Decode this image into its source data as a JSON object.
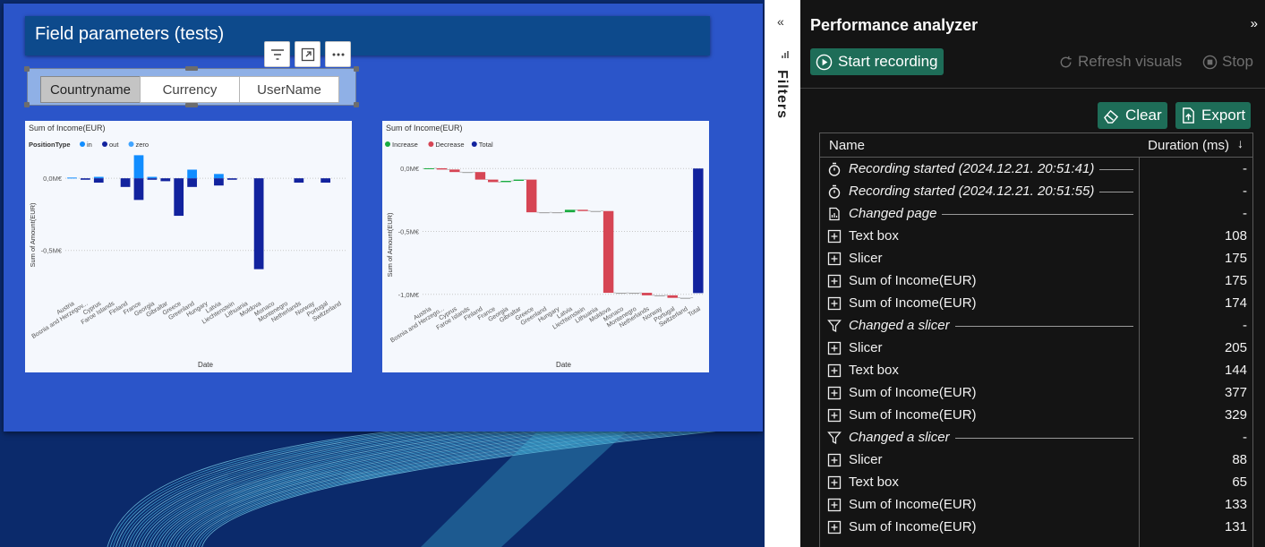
{
  "report": {
    "title": "Field parameters (tests)",
    "slicer": {
      "options": [
        "Countryname",
        "Currency",
        "UserName"
      ],
      "selected_index": 0
    },
    "toolbar_icons": [
      "filter-icon",
      "focus-mode-icon",
      "more-options-icon"
    ]
  },
  "chart_data": [
    {
      "type": "bar",
      "title": "Sum of Income(EUR)",
      "legend_title": "PositionType",
      "legend_position": "top-left",
      "xlabel": "Date",
      "ylabel": "Sum of Amount(EUR)",
      "y_ticks": [
        "0,0M€",
        "-0,5M€"
      ],
      "ylim": [
        -0.75,
        0.15
      ],
      "grid": true,
      "categories": [
        "Austria",
        "Bosnia and Herzegov...",
        "Cyprus",
        "Faroe Islands",
        "Finland",
        "France",
        "Georgia",
        "Gibraltar",
        "Greece",
        "Greenland",
        "Hungary",
        "Latvia",
        "Liechtenstein",
        "Lithuania",
        "Moldova",
        "Monaco",
        "Montenegro",
        "Netherlands",
        "Norway",
        "Portugal",
        "Switzerland"
      ],
      "series": [
        {
          "name": "in",
          "color": "#118dff",
          "values": [
            0.005,
            0.0,
            0.01,
            0.0,
            0.0,
            0.16,
            0.01,
            0.0,
            0.0,
            0.06,
            0.0,
            0.03,
            0.0,
            0.0,
            0.0,
            0.0,
            0.0,
            0.0,
            0.0,
            0.0,
            0.0
          ]
        },
        {
          "name": "out",
          "color": "#12239e",
          "values": [
            0.0,
            -0.01,
            -0.03,
            0.0,
            -0.06,
            -0.15,
            -0.01,
            -0.02,
            -0.26,
            -0.06,
            0.0,
            -0.05,
            -0.01,
            0.0,
            -0.63,
            0.0,
            0.0,
            -0.03,
            0.0,
            -0.03,
            0.0
          ]
        },
        {
          "name": "zero",
          "color": "#41a4ff",
          "values": [
            0,
            0,
            0,
            0,
            0,
            0,
            0,
            0,
            0,
            0,
            0,
            0,
            0,
            0,
            0,
            0,
            0,
            0,
            0,
            0,
            0
          ]
        }
      ]
    },
    {
      "type": "bar",
      "subtype": "waterfall",
      "title": "Sum of Income(EUR)",
      "legend_position": "top-left",
      "legend": [
        {
          "name": "Increase",
          "color": "#1aab40"
        },
        {
          "name": "Decrease",
          "color": "#d64554"
        },
        {
          "name": "Total",
          "color": "#12239e"
        }
      ],
      "xlabel": "Date",
      "ylabel": "Sum of Amount(EUR)",
      "y_ticks": [
        "0,0M€",
        "-0,5M€",
        "-1,0M€"
      ],
      "ylim": [
        -1.08,
        0.08
      ],
      "grid": true,
      "categories": [
        "Austria",
        "Bosnia and Herzego...",
        "Cyprus",
        "Faroe Islands",
        "Finland",
        "France",
        "Georgia",
        "Gibraltar",
        "Greece",
        "Greenland",
        "Hungary",
        "Latvia",
        "Liechtenstein",
        "Lithuania",
        "Moldova",
        "Monaco",
        "Montenegro",
        "Netherlands",
        "Norway",
        "Portugal",
        "Switzerland",
        "Total"
      ],
      "values": [
        0.002,
        -0.01,
        -0.02,
        0.0,
        -0.06,
        -0.02,
        0.01,
        0.01,
        -0.26,
        0.0,
        0.0,
        0.02,
        -0.01,
        0.0,
        -0.65,
        0.0,
        0.0,
        -0.02,
        0.0,
        -0.02,
        0.0,
        -0.99
      ]
    }
  ],
  "filters_pane": {
    "label": "Filters",
    "collapse_glyph": "«"
  },
  "perf": {
    "title": "Performance analyzer",
    "collapse_glyph": "»",
    "start_label": "Start recording",
    "refresh_label": "Refresh visuals",
    "stop_label": "Stop",
    "clear_label": "Clear",
    "export_label": "Export",
    "col_name": "Name",
    "col_duration": "Duration (ms)",
    "rows": [
      {
        "icon": "stopwatch-icon",
        "name": "Recording started (2024.12.21. 20:51:41)",
        "duration": "-",
        "event": true
      },
      {
        "icon": "stopwatch-icon",
        "name": "Recording started (2024.12.21. 20:51:55)",
        "duration": "-",
        "event": true
      },
      {
        "icon": "page-icon",
        "name": "Changed page",
        "duration": "-",
        "event": true
      },
      {
        "icon": "expand-icon",
        "name": "Text box",
        "duration": "108",
        "event": false
      },
      {
        "icon": "expand-icon",
        "name": "Slicer",
        "duration": "175",
        "event": false
      },
      {
        "icon": "expand-icon",
        "name": "Sum of Income(EUR)",
        "duration": "175",
        "event": false
      },
      {
        "icon": "expand-icon",
        "name": "Sum of Income(EUR)",
        "duration": "174",
        "event": false
      },
      {
        "icon": "filter-icon",
        "name": "Changed a slicer",
        "duration": "-",
        "event": true
      },
      {
        "icon": "expand-icon",
        "name": "Slicer",
        "duration": "205",
        "event": false
      },
      {
        "icon": "expand-icon",
        "name": "Text box",
        "duration": "144",
        "event": false
      },
      {
        "icon": "expand-icon",
        "name": "Sum of Income(EUR)",
        "duration": "377",
        "event": false
      },
      {
        "icon": "expand-icon",
        "name": "Sum of Income(EUR)",
        "duration": "329",
        "event": false
      },
      {
        "icon": "filter-icon",
        "name": "Changed a slicer",
        "duration": "-",
        "event": true
      },
      {
        "icon": "expand-icon",
        "name": "Slicer",
        "duration": "88",
        "event": false
      },
      {
        "icon": "expand-icon",
        "name": "Text box",
        "duration": "65",
        "event": false
      },
      {
        "icon": "expand-icon",
        "name": "Sum of Income(EUR)",
        "duration": "133",
        "event": false
      },
      {
        "icon": "expand-icon",
        "name": "Sum of Income(EUR)",
        "duration": "131",
        "event": false
      }
    ]
  }
}
